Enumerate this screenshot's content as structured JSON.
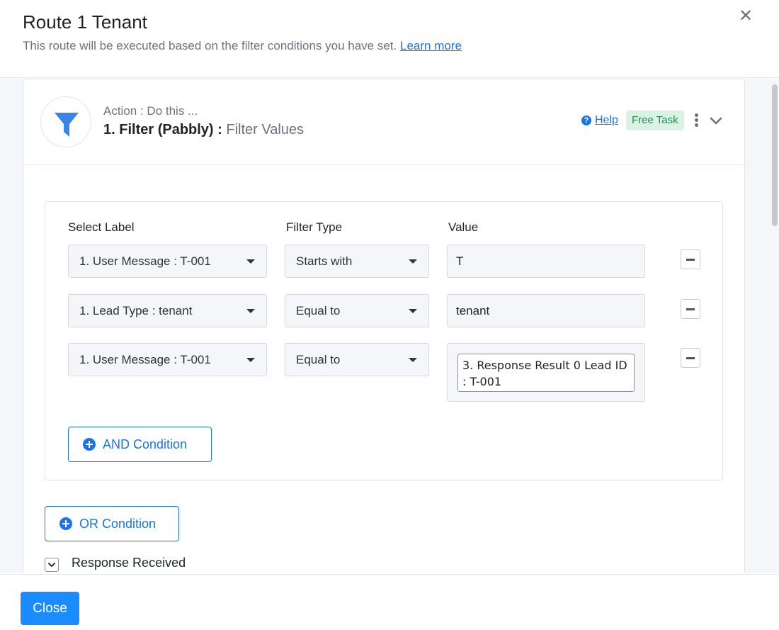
{
  "header": {
    "title": "Route 1 Tenant",
    "subtitle": "This route will be executed based on the filter conditions you have set.",
    "learn_more": "Learn more",
    "close_icon": "close-icon"
  },
  "action": {
    "label": "Action : Do this ...",
    "title": "1. Filter (Pabbly) :",
    "subtitle": "Filter Values",
    "help": "Help",
    "badge": "Free Task",
    "app_icon": "filter-funnel-icon",
    "accent_color": "#1a73e8"
  },
  "filter": {
    "columns": {
      "label": "Select Label",
      "type": "Filter Type",
      "value": "Value"
    },
    "rows": [
      {
        "label": "1. User Message : T-001",
        "type": "Starts with",
        "value": "T"
      },
      {
        "label": "1. Lead Type : tenant",
        "type": "Equal to",
        "value": "tenant"
      },
      {
        "label": "1. User Message : T-001",
        "type": "Equal to",
        "value": "3. Response Result 0 Lead ID : T-001"
      }
    ],
    "and_button": "AND Condition"
  },
  "or_button": "OR Condition",
  "response": {
    "label": "Response Received"
  },
  "footer": {
    "close_label": "Close"
  }
}
